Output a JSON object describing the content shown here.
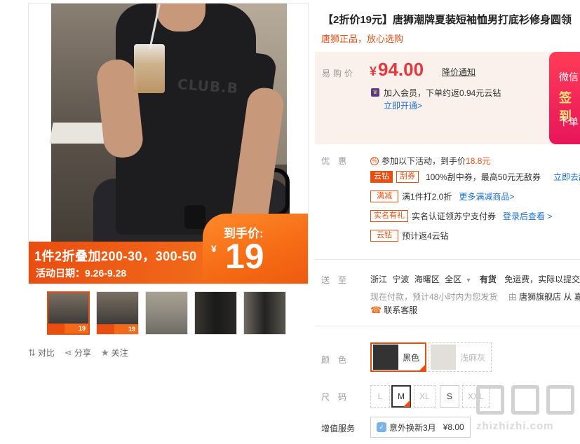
{
  "gallery": {
    "shirt_print": "CLUB.B",
    "promo_line1": "1件2折叠加200-30，300-50",
    "promo_line2": "活动日期：9.26-9.28",
    "promo_price_label": "到手价:",
    "promo_currency": "¥",
    "promo_price": "19",
    "thumbs": [
      {
        "badge": "19",
        "active": true
      },
      {
        "badge": "19",
        "active": false
      },
      {
        "badge": "",
        "active": false
      },
      {
        "badge": "",
        "active": false
      },
      {
        "badge": "",
        "active": false
      }
    ],
    "actions": [
      {
        "icon": "compare-icon",
        "label": "对比"
      },
      {
        "icon": "share-icon",
        "label": "分享"
      },
      {
        "icon": "star-icon",
        "label": "关注"
      }
    ]
  },
  "product": {
    "title": "【2折价19元】唐狮潮牌夏装短袖恤男打底衫修身圆领",
    "subtitle": "唐狮正品，放心选购"
  },
  "price_box": {
    "label": "易购价",
    "currency": "¥",
    "price": "94.00",
    "notify_link": "降价通知",
    "vip_text": "加入会员，下单约返0.94元云钻",
    "vip_link": "立即开通>",
    "side_banner": {
      "line1": "微信",
      "line2": "签到",
      "line3": "下单"
    }
  },
  "promotions": {
    "label": "优惠",
    "summary_prefix": "参加以下活动，到手价",
    "summary_price": "18.8元",
    "rows": [
      {
        "tags": [
          "云钻",
          "刮券"
        ],
        "text": "100%刮中券，最高50元无敌券",
        "link": "立即去刮"
      },
      {
        "tags": [
          "满减"
        ],
        "text": "满1件打2.0折",
        "link": "更多满减商品>"
      },
      {
        "tags": [
          "实名有礼"
        ],
        "text": "实名认证领苏宁支付券",
        "link": "登录后查看 >"
      },
      {
        "tags": [
          "云钻"
        ],
        "text": "预计返4云钻",
        "link": ""
      }
    ]
  },
  "shipping": {
    "label": "送至",
    "region": [
      "浙江",
      "宁波",
      "海曙区",
      "全区"
    ],
    "stock": "有货",
    "fee": "免运费，实际以提交订",
    "note": "现在付款，预计48小时内为您发货",
    "seller_prefix": "由",
    "seller": "唐狮旗舰店",
    "seller_suffix": "从 嘉",
    "service": "联系客服"
  },
  "color": {
    "label": "颜色",
    "options": [
      {
        "name": "黑色",
        "selected": true,
        "disabled": false
      },
      {
        "name": "浅麻灰",
        "selected": false,
        "disabled": true
      }
    ]
  },
  "size": {
    "label": "尺码",
    "options": [
      {
        "name": "L",
        "selected": false,
        "disabled": true
      },
      {
        "name": "M",
        "selected": true,
        "disabled": false
      },
      {
        "name": "XL",
        "selected": false,
        "disabled": true
      },
      {
        "name": "S",
        "selected": false,
        "disabled": false
      },
      {
        "name": "XXL",
        "selected": false,
        "disabled": true
      }
    ]
  },
  "value_added": {
    "label": "增值服务",
    "option": "意外换新3月",
    "price": "¥8.00"
  },
  "watermark": "zhizhizhi.com",
  "colors": {
    "accent": "#e94e11",
    "price": "#e4393c",
    "link": "#1a6fd4"
  }
}
